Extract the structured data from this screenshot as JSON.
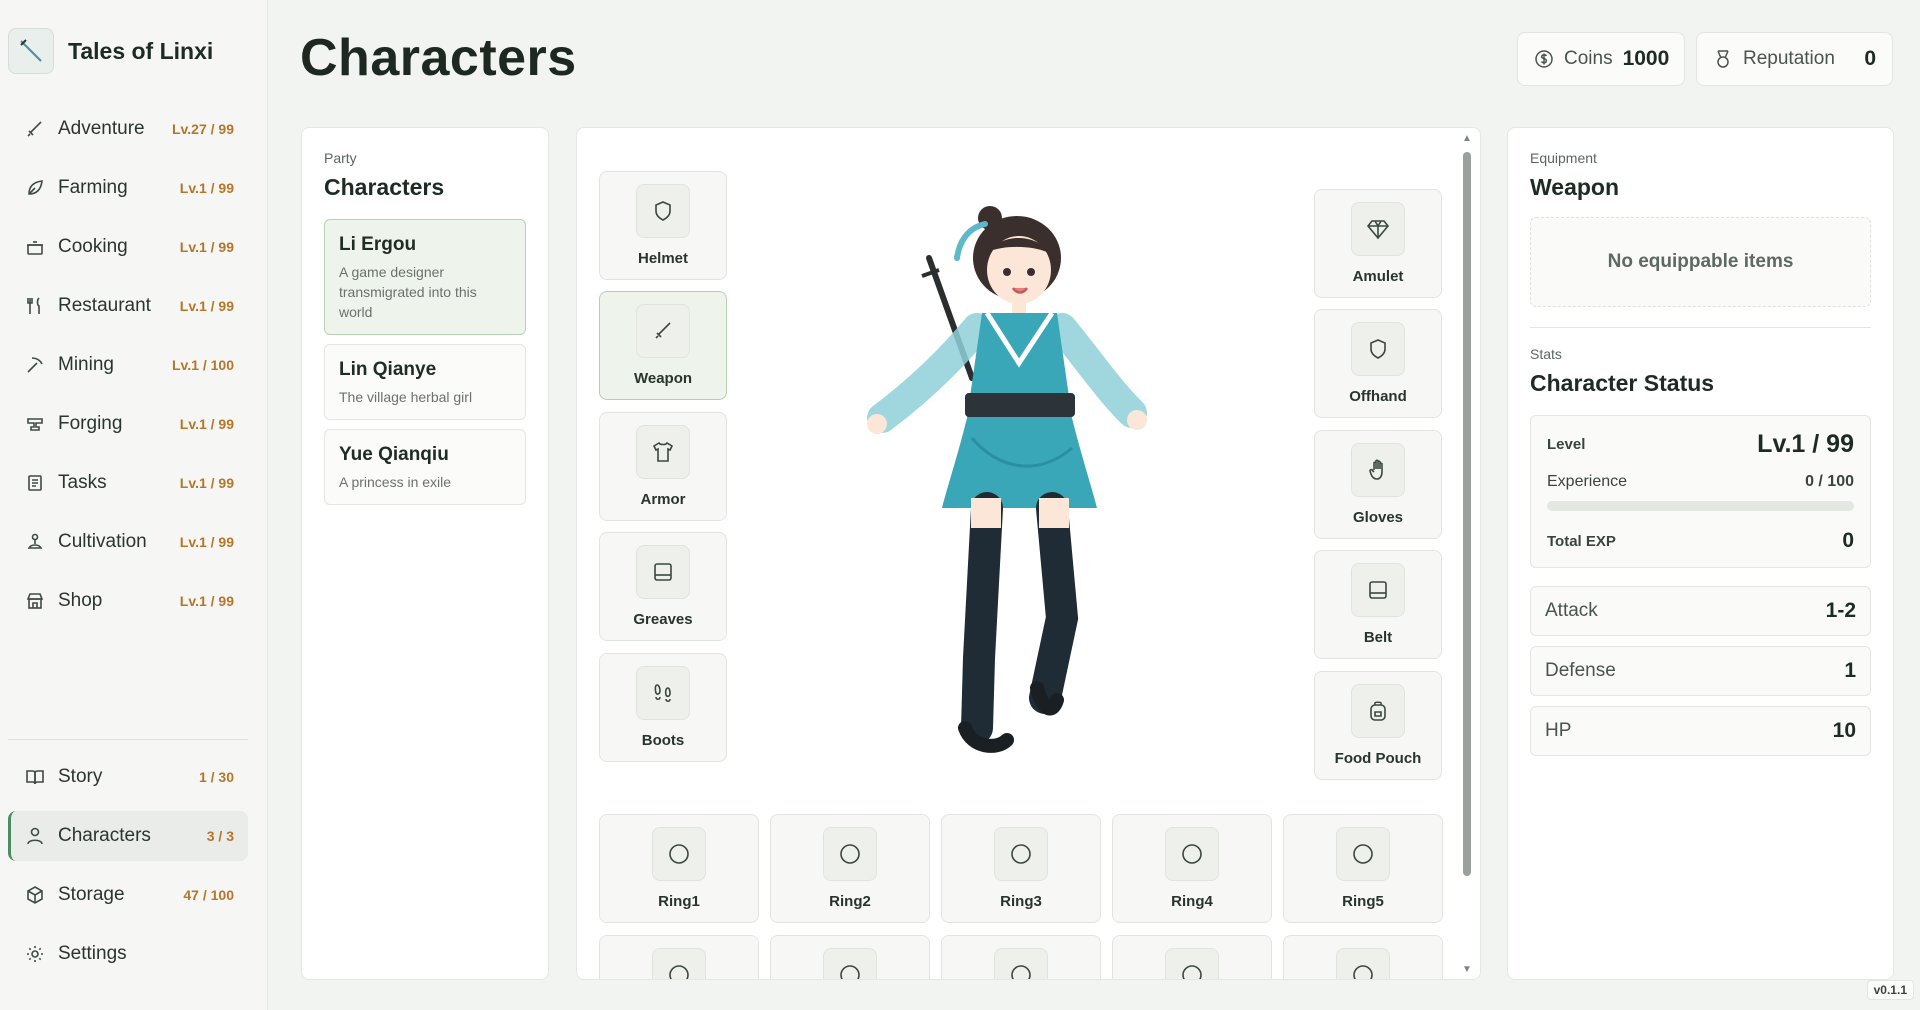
{
  "app": {
    "title": "Tales of Linxi",
    "version": "v0.1.1"
  },
  "sidebar": {
    "top_items": [
      {
        "label": "Adventure",
        "badge": "Lv.27 / 99",
        "icon": "sword-icon"
      },
      {
        "label": "Farming",
        "badge": "Lv.1 / 99",
        "icon": "leaf-icon"
      },
      {
        "label": "Cooking",
        "badge": "Lv.1 / 99",
        "icon": "pot-icon"
      },
      {
        "label": "Restaurant",
        "badge": "Lv.1 / 99",
        "icon": "utensils-icon"
      },
      {
        "label": "Mining",
        "badge": "Lv.1 / 100",
        "icon": "pickaxe-icon"
      },
      {
        "label": "Forging",
        "badge": "Lv.1 / 99",
        "icon": "anvil-icon"
      },
      {
        "label": "Tasks",
        "badge": "Lv.1 / 99",
        "icon": "scroll-icon"
      },
      {
        "label": "Cultivation",
        "badge": "Lv.1 / 99",
        "icon": "meditation-icon"
      },
      {
        "label": "Shop",
        "badge": "Lv.1 / 99",
        "icon": "store-icon"
      }
    ],
    "bottom_items": [
      {
        "label": "Story",
        "badge": "1 / 30",
        "icon": "book-icon"
      },
      {
        "label": "Characters",
        "badge": "3 / 3",
        "icon": "user-icon",
        "active": true
      },
      {
        "label": "Storage",
        "badge": "47 / 100",
        "icon": "box-icon"
      },
      {
        "label": "Settings",
        "badge": "",
        "icon": "gear-icon"
      }
    ]
  },
  "header": {
    "title": "Characters",
    "coins_label": "Coins",
    "coins_value": "1000",
    "rep_label": "Reputation",
    "rep_value": "0"
  },
  "party": {
    "eyebrow": "Party",
    "title": "Characters",
    "characters": [
      {
        "name": "Li Ergou",
        "desc": "A game designer transmigrated into this world",
        "selected": true
      },
      {
        "name": "Lin Qianye",
        "desc": "The village herbal girl"
      },
      {
        "name": "Yue Qianqiu",
        "desc": "A princess in exile"
      }
    ]
  },
  "equipment_slots": {
    "left": [
      {
        "label": "Helmet",
        "icon": "shield-icon"
      },
      {
        "label": "Weapon",
        "icon": "sword-icon",
        "selected": true
      },
      {
        "label": "Armor",
        "icon": "shirt-icon"
      },
      {
        "label": "Greaves",
        "icon": "greaves-icon"
      },
      {
        "label": "Boots",
        "icon": "footprints-icon"
      }
    ],
    "right": [
      {
        "label": "Amulet",
        "icon": "gem-icon"
      },
      {
        "label": "Offhand",
        "icon": "shield-icon"
      },
      {
        "label": "Gloves",
        "icon": "hand-icon"
      },
      {
        "label": "Belt",
        "icon": "belt-icon"
      },
      {
        "label": "Food Pouch",
        "icon": "backpack-icon"
      }
    ],
    "rings": [
      "Ring1",
      "Ring2",
      "Ring3",
      "Ring4",
      "Ring5"
    ]
  },
  "detail": {
    "eyebrow": "Equipment",
    "title": "Weapon",
    "empty_text": "No equippable items",
    "stats_eyebrow": "Stats",
    "stats_title": "Character Status",
    "level_label": "Level",
    "level_value": "Lv.1 / 99",
    "exp_label": "Experience",
    "exp_value": "0 / 100",
    "exp_fraction": 0,
    "total_exp_label": "Total EXP",
    "total_exp_value": "0",
    "attributes": [
      {
        "label": "Attack",
        "value": "1-2"
      },
      {
        "label": "Defense",
        "value": "1"
      },
      {
        "label": "HP",
        "value": "10"
      }
    ]
  },
  "colors": {
    "accent": "#4c8c62",
    "badge": "#b5762a",
    "background": "#f2f4f1"
  }
}
